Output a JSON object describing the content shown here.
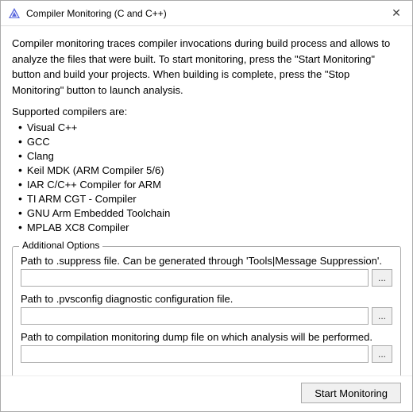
{
  "window": {
    "title": "Compiler Monitoring (C and C++)",
    "close_icon": "✕"
  },
  "description": "Compiler monitoring traces compiler invocations during build process and allows to analyze the files that were built. To start monitoring, press the \"Start Monitoring\" button and build your projects. When building is complete, press the \"Stop Monitoring\" button to launch analysis.",
  "supported_label": "Supported compilers are:",
  "compilers": [
    "Visual C++",
    "GCC",
    "Clang",
    "Keil MDK (ARM Compiler 5/6)",
    "IAR C/C++ Compiler for ARM",
    "TI ARM CGT - Compiler",
    "GNU Arm Embedded Toolchain",
    "MPLAB XC8 Compiler"
  ],
  "options_group": {
    "legend": "Additional Options",
    "fields": [
      {
        "label": "Path to .suppress file. Can be generated through 'Tools|Message Suppression'.",
        "placeholder": "",
        "browse_label": "..."
      },
      {
        "label": "Path to .pvsconfig diagnostic configuration file.",
        "placeholder": "",
        "browse_label": "..."
      },
      {
        "label": "Path to compilation monitoring dump file on which analysis will be performed.",
        "placeholder": "",
        "browse_label": "..."
      }
    ]
  },
  "footer": {
    "start_button_label": "Start Monitoring"
  }
}
